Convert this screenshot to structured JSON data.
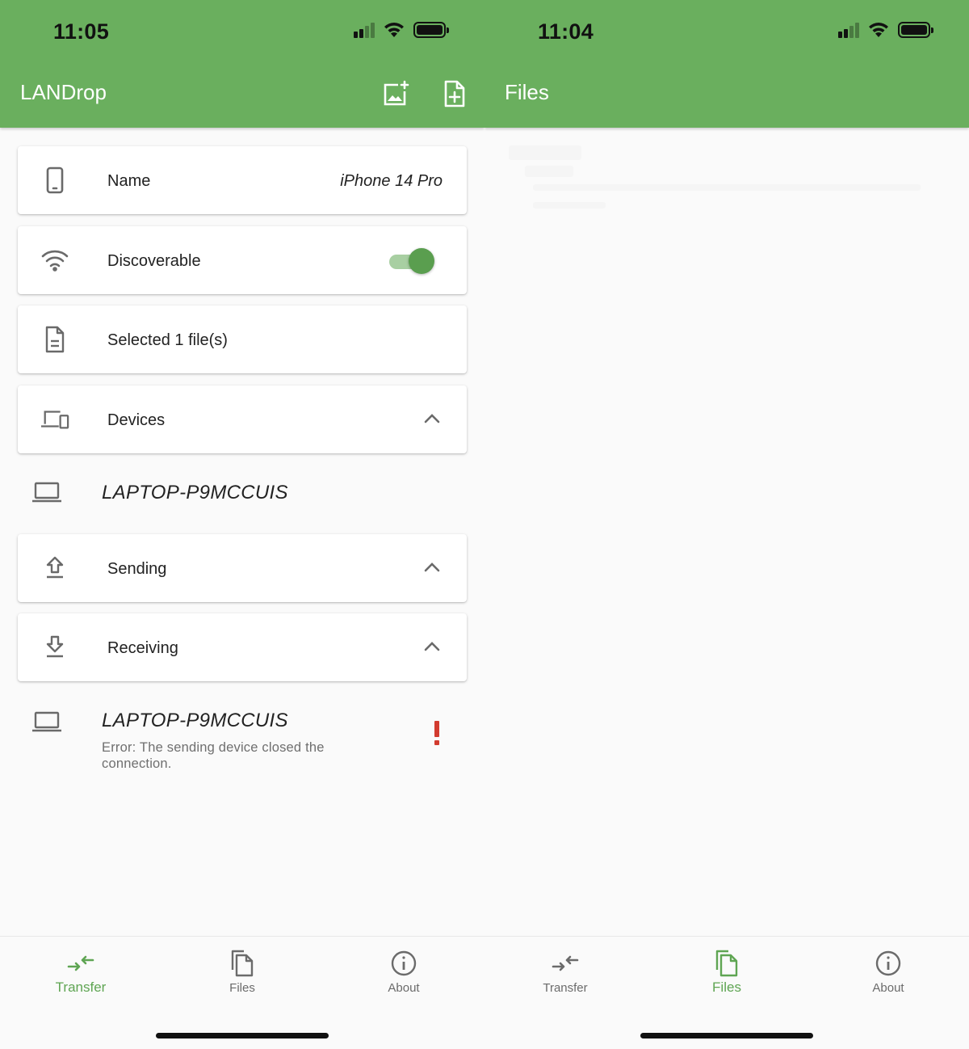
{
  "colors": {
    "appbar": "#6aaf5e",
    "accent": "#5fa553",
    "toggle_knob": "#5a9e4f",
    "toggle_track": "#a8cfa2",
    "error": "#d23b2f",
    "background": "#fafafa"
  },
  "left_screen": {
    "status_bar": {
      "time": "11:05",
      "icons": [
        "cellular-signal-icon",
        "wifi-icon",
        "battery-icon"
      ]
    },
    "app_bar": {
      "title": "LANDrop",
      "actions": [
        {
          "name": "add-image-icon",
          "label": "Add image"
        },
        {
          "name": "add-file-icon",
          "label": "Add file"
        }
      ]
    },
    "settings": {
      "name": {
        "icon": "phone-icon",
        "label": "Name",
        "value": "iPhone 14 Pro"
      },
      "discoverable": {
        "icon": "wifi-icon",
        "label": "Discoverable",
        "enabled": true
      },
      "selected_files": {
        "icon": "document-icon",
        "label": "Selected 1 file(s)"
      },
      "devices": {
        "icon": "devices-icon",
        "label": "Devices",
        "expanded": true
      },
      "sending": {
        "icon": "upload-icon",
        "label": "Sending",
        "expanded": true
      },
      "receiving": {
        "icon": "download-icon",
        "label": "Receiving",
        "expanded": true
      }
    },
    "devices_list": [
      {
        "icon": "laptop-icon",
        "name": "LAPTOP-P9MCCUIS"
      }
    ],
    "receiving_list": [
      {
        "icon": "laptop-icon",
        "name": "LAPTOP-P9MCCUIS",
        "status": "Error: The sending device closed the connection.",
        "status_icon": "error-exclamation-icon"
      }
    ],
    "bottom_nav": {
      "active": "Transfer",
      "items": [
        {
          "label": "Transfer",
          "icon": "transfer-arrows-icon"
        },
        {
          "label": "Files",
          "icon": "files-icon"
        },
        {
          "label": "About",
          "icon": "info-icon"
        }
      ]
    }
  },
  "right_screen": {
    "status_bar": {
      "time": "11:04",
      "icons": [
        "cellular-signal-icon",
        "wifi-icon",
        "battery-icon"
      ]
    },
    "app_bar": {
      "title": "Files"
    },
    "bottom_nav": {
      "active": "Files",
      "items": [
        {
          "label": "Transfer",
          "icon": "transfer-arrows-icon"
        },
        {
          "label": "Files",
          "icon": "files-icon"
        },
        {
          "label": "About",
          "icon": "info-icon"
        }
      ]
    }
  }
}
